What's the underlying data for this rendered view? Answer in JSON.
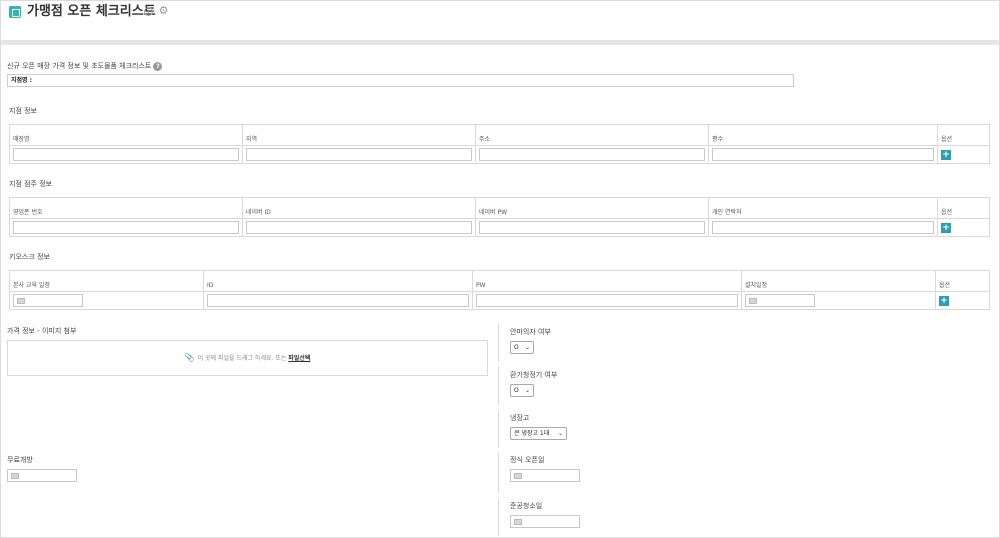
{
  "header": {
    "title": "가맹점 오픈 체크리스트",
    "icon": "checklist-icon",
    "accent": "#2fb5b5"
  },
  "intro": {
    "label": "신규 오픈 매장 가격 정보 및 초도물품 체크리스트",
    "branch_label": "지점명 :"
  },
  "branch_info": {
    "title": "지점 정보",
    "columns": [
      "매장명",
      "지역",
      "주소",
      "평수",
      "옵션"
    ],
    "add_label": "+"
  },
  "owner_info": {
    "title": "지점 점주 정보",
    "columns": [
      "영업폰 번호",
      "네이버 ID",
      "네이버 PW",
      "개인 연락처",
      "옵션"
    ],
    "add_label": "+"
  },
  "kiosk_info": {
    "title": "키오스크 정보",
    "columns": [
      "본사 교육 일정",
      "ID",
      "PW",
      "설치일정",
      "옵션"
    ],
    "add_label": "+"
  },
  "price_info": {
    "title": "가격 정보 - 이미지 첨부",
    "drop_text": "이 곳에 파일을 드래그 하세요. 또는",
    "file_link": "파일선택"
  },
  "right_panel": {
    "massage_chair": {
      "label": "안마의자 여부",
      "value": "O"
    },
    "ventilator": {
      "label": "환기청정기 여부",
      "value": "O"
    },
    "fridge": {
      "label": "냉장고",
      "value": "큰 냉장고 1대"
    },
    "open_date": {
      "label": "정식 오픈일"
    },
    "cleaning_date": {
      "label": "준공청소일"
    }
  },
  "free_open": {
    "label": "무료개방"
  },
  "colors": {
    "add_button": "#2a9fb0",
    "border": "#d9d9d9"
  }
}
